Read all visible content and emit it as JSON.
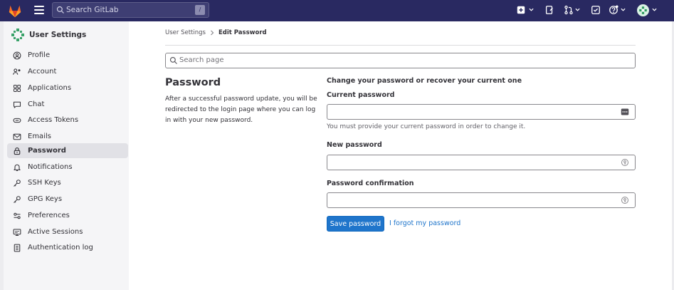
{
  "topbar": {
    "search_placeholder": "Search GitLab",
    "search_shortcut": "/"
  },
  "sidebar": {
    "title": "User Settings",
    "items": [
      {
        "label": "Profile",
        "icon": "profile-icon"
      },
      {
        "label": "Account",
        "icon": "account-icon"
      },
      {
        "label": "Applications",
        "icon": "applications-icon"
      },
      {
        "label": "Chat",
        "icon": "chat-icon"
      },
      {
        "label": "Access Tokens",
        "icon": "token-icon"
      },
      {
        "label": "Emails",
        "icon": "mail-icon"
      },
      {
        "label": "Password",
        "icon": "lock-icon",
        "active": true
      },
      {
        "label": "Notifications",
        "icon": "bell-icon"
      },
      {
        "label": "SSH Keys",
        "icon": "key-icon"
      },
      {
        "label": "GPG Keys",
        "icon": "key-icon"
      },
      {
        "label": "Preferences",
        "icon": "preferences-icon"
      },
      {
        "label": "Active Sessions",
        "icon": "monitor-icon"
      },
      {
        "label": "Authentication log",
        "icon": "log-icon"
      }
    ]
  },
  "breadcrumb": {
    "parent": "User Settings",
    "current": "Edit Password"
  },
  "search_page": {
    "placeholder": "Search page"
  },
  "section": {
    "title": "Password",
    "description": "After a successful password update, you will be redirected to the login page where you can log in with your new password."
  },
  "form": {
    "heading": "Change your password or recover your current one",
    "current_label": "Current password",
    "current_value": "",
    "current_help": "You must provide your current password in order to change it.",
    "new_label": "New password",
    "new_value": "",
    "confirm_label": "Password confirmation",
    "confirm_value": "",
    "save_label": "Save password",
    "forgot_label": "I forgot my password"
  },
  "colors": {
    "topbar": "#292961",
    "primary": "#1f75cb",
    "sidebar_bg": "#f5f5f7",
    "active_item": "#e1e1e6"
  }
}
